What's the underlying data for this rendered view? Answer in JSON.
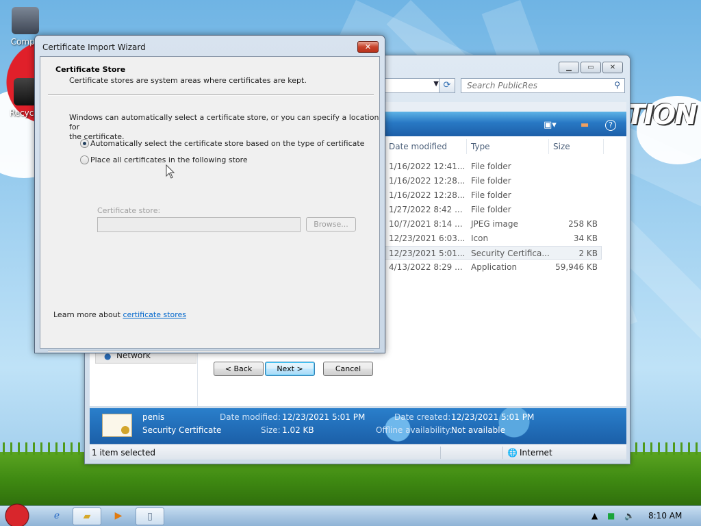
{
  "desktop": {
    "icons": [
      {
        "label": "Compu"
      },
      {
        "label": "Recycle"
      }
    ],
    "art_text": "TION"
  },
  "explorer": {
    "search_placeholder": "Search PublicRes",
    "nav_network": "Network",
    "columns": [
      "Date modified",
      "Type",
      "Size"
    ],
    "rows": [
      {
        "date": "1/16/2022 12:41...",
        "type": "File folder",
        "size": ""
      },
      {
        "date": "1/16/2022 12:28...",
        "type": "File folder",
        "size": ""
      },
      {
        "date": "1/16/2022 12:28...",
        "type": "File folder",
        "size": ""
      },
      {
        "date": "1/27/2022 8:42 ...",
        "type": "File folder",
        "size": ""
      },
      {
        "date": "10/7/2021 8:14 ...",
        "type": "JPEG image",
        "size": "258 KB"
      },
      {
        "date": "12/23/2021 6:03...",
        "type": "Icon",
        "size": "34 KB"
      },
      {
        "date": "12/23/2021 5:01...",
        "type": "Security Certifica...",
        "size": "2 KB",
        "selected": true
      },
      {
        "date": "4/13/2022 8:29 ...",
        "type": "Application",
        "size": "59,946 KB"
      }
    ],
    "details": {
      "name": "penis",
      "kind": "Security Certificate",
      "modified_label": "Date modified:",
      "modified_value": "12/23/2021 5:01 PM",
      "size_label": "Size:",
      "size_value": "1.02 KB",
      "created_label": "Date created:",
      "created_value": "12/23/2021 5:01 PM",
      "offline_label": "Offline availability:",
      "offline_value": "Not available"
    },
    "status": {
      "selection": "1 item selected",
      "zone": "Internet"
    }
  },
  "wizard": {
    "title": "Certificate Import Wizard",
    "header_title": "Certificate Store",
    "header_subtitle": "Certificate stores are system areas where certificates are kept.",
    "intro_line1": "Windows can automatically select a certificate store, or you can specify a location for",
    "intro_line2": "the certificate.",
    "option_auto": "Automatically select the certificate store based on the type of certificate",
    "option_manual": "Place all certificates in the following store",
    "store_label": "Certificate store:",
    "store_value": "",
    "browse_label": "Browse...",
    "learn_more_prefix": "Learn more about ",
    "learn_more_link": "certificate stores",
    "back_label": "< Back",
    "next_label": "Next >",
    "cancel_label": "Cancel",
    "selected_option": "auto"
  },
  "taskbar": {
    "clock": "8:10 AM"
  },
  "icons": {
    "close": "close-icon",
    "minimize": "minimize-icon",
    "maximize": "maximize-icon",
    "search": "search-icon",
    "refresh": "refresh-icon",
    "help": "help-icon"
  }
}
